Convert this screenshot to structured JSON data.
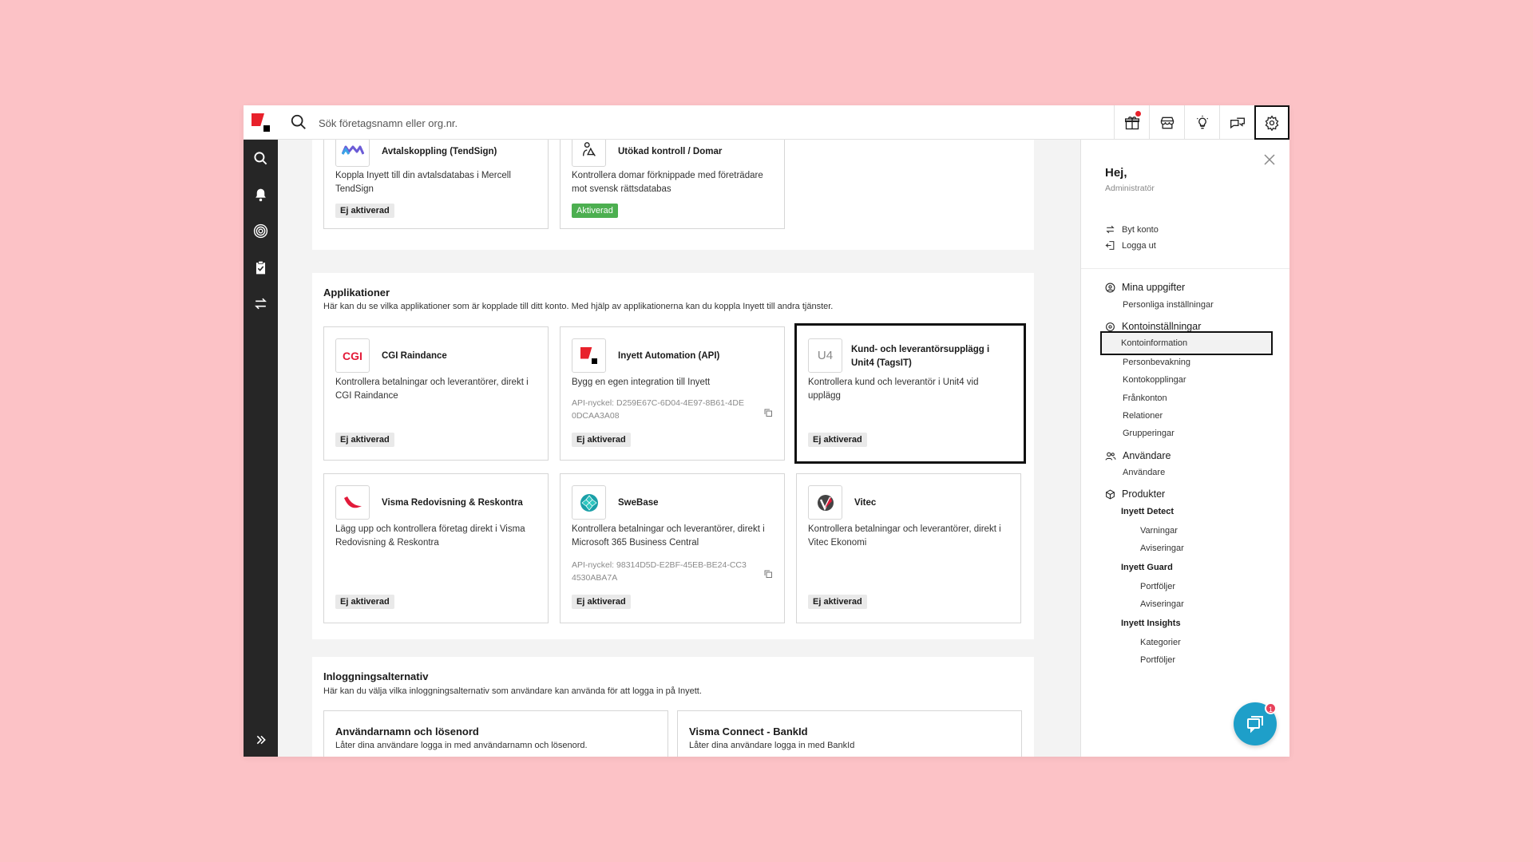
{
  "search": {
    "placeholder": "Sök företagsnamn eller org.nr."
  },
  "topbar": {
    "icons": [
      "gift-icon",
      "store-icon",
      "lightbulb-icon",
      "chat-bubbles-icon",
      "gear-icon"
    ]
  },
  "rail": {
    "icons": [
      "search-icon",
      "bell-icon",
      "fingerprint-icon",
      "clipboard-check-icon",
      "swap-arrows-icon",
      "double-chevron-right-icon"
    ]
  },
  "integrations": {
    "cards": [
      {
        "title": "Avtalskoppling (TendSign)",
        "description": "Koppla Inyett till din avtalsdatabas i Mercell TendSign",
        "status": "Ej aktiverad"
      },
      {
        "title": "Utökad kontroll / Domar",
        "description": "Kontrollera domar förknippade med företrädare mot svensk rättsdatabas",
        "status": "Aktiverad"
      }
    ]
  },
  "applications": {
    "title": "Applikationer",
    "description": "Här kan du se vilka applikationer som är kopplade till ditt konto. Med hjälp av applikationerna kan du koppla Inyett till andra tjänster.",
    "cards": [
      {
        "title": "CGI Raindance",
        "logo_text": "CGI",
        "description": "Kontrollera betalningar och leverantörer, direkt i CGI Raindance",
        "status": "Ej aktiverad"
      },
      {
        "title": "Inyett Automation (API)",
        "description": "Bygg en egen integration till Inyett",
        "api_key": "API-nyckel: D259E67C-6D04-4E97-8B61-4DE0DCAA3A08",
        "status": "Ej aktiverad"
      },
      {
        "title": "Kund- och leverantörsupplägg i Unit4 (TagsIT)",
        "logo_text": "U4",
        "description": "Kontrollera kund och leverantör i Unit4 vid upplägg",
        "status": "Ej aktiverad"
      },
      {
        "title": "Visma Redovisning & Reskontra",
        "description": "Lägg upp och kontrollera företag direkt i Visma Redovisning & Reskontra",
        "status": "Ej aktiverad"
      },
      {
        "title": "SweBase",
        "description": "Kontrollera betalningar och leverantörer, direkt i Microsoft 365 Business Central",
        "api_key": "API-nyckel: 98314D5D-E2BF-45EB-BE24-CC34530ABA7A",
        "status": "Ej aktiverad"
      },
      {
        "title": "Vitec",
        "description": "Kontrollera betalningar och leverantörer, direkt i Vitec Ekonomi",
        "status": "Ej aktiverad"
      }
    ]
  },
  "login_options": {
    "title": "Inloggningsalternativ",
    "description": "Här kan du välja vilka inloggningsalternativ som användare kan använda för att logga in på Inyett.",
    "cards": [
      {
        "title": "Användarnamn och lösenord",
        "description": "Låter dina användare logga in med användarnamn och lösenord."
      },
      {
        "title": "Visma Connect - BankId",
        "description": "Låter dina användare logga in med BankId"
      }
    ]
  },
  "panel": {
    "greeting": "Hej,",
    "role": "Administratör",
    "switch_account": "Byt konto",
    "logout": "Logga ut",
    "groups": {
      "tasks": {
        "label": "Mina uppgifter",
        "items": [
          "Personliga inställningar"
        ]
      },
      "account": {
        "label": "Kontoinställningar",
        "items": [
          "Kontoinformation",
          "Personbevakning",
          "Kontokopplingar",
          "Frånkonton",
          "Relationer",
          "Grupperingar"
        ]
      },
      "users": {
        "label": "Användare",
        "items": [
          "Användare"
        ]
      },
      "products": {
        "label": "Produkter",
        "detect": {
          "label": "Inyett Detect",
          "items": [
            "Varningar",
            "Aviseringar"
          ]
        },
        "guard": {
          "label": "Inyett Guard",
          "items": [
            "Portföljer",
            "Aviseringar"
          ]
        },
        "insights": {
          "label": "Inyett Insights",
          "items": [
            "Kategorier",
            "Portföljer"
          ]
        }
      }
    }
  },
  "chat": {
    "count": "1"
  }
}
